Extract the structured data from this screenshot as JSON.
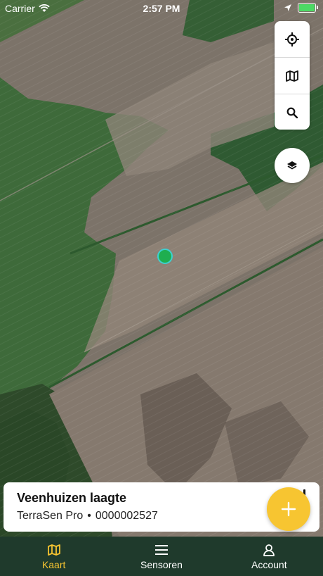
{
  "status_bar": {
    "carrier": "Carrier",
    "time": "2:57 PM",
    "battery_level": 1.0
  },
  "map": {
    "controls": [
      {
        "name": "locate-button",
        "icon": "crosshair-icon"
      },
      {
        "name": "map-type-button",
        "icon": "map-icon"
      },
      {
        "name": "search-button",
        "icon": "search-icon"
      }
    ],
    "layers_icon": "layers-icon",
    "marker_color": "#1fae4f"
  },
  "sensor_card": {
    "name": "Veenhuizen laagte",
    "model": "TerraSen Pro",
    "separator": "•",
    "serial": "0000002527"
  },
  "fab": {
    "icon": "plus-icon",
    "color": "#f7c531"
  },
  "tabs": [
    {
      "label": "Kaart",
      "icon": "map-icon",
      "active": true
    },
    {
      "label": "Sensoren",
      "icon": "menu-icon",
      "active": false
    },
    {
      "label": "Account",
      "icon": "user-icon",
      "active": false
    }
  ],
  "colors": {
    "accent": "#f7c531",
    "tab_bar": "#1f3a2c"
  }
}
